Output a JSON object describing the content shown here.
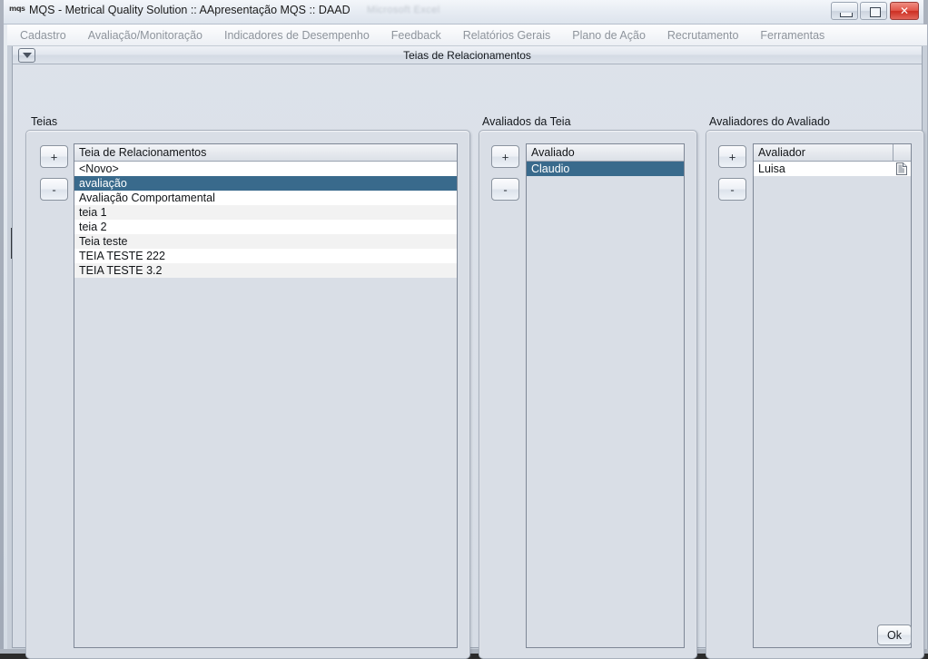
{
  "window": {
    "title": "MQS - Metrical Quality Solution :: AApresentação MQS :: DAAD",
    "logo": "mqs",
    "ghost_text": "Microsoft Excel",
    "controls": {
      "minimize": "minimize-button",
      "maximize": "maximize-button",
      "close": "✕"
    }
  },
  "menubar": {
    "items": [
      {
        "label": "Cadastro"
      },
      {
        "label": "Avaliação/Monitoração"
      },
      {
        "label": "Indicadores de Desempenho"
      },
      {
        "label": "Feedback"
      },
      {
        "label": "Relatórios Gerais"
      },
      {
        "label": "Plano de Ação"
      },
      {
        "label": "Recrutamento"
      },
      {
        "label": "Ferramentas"
      }
    ]
  },
  "form": {
    "caption": "Teias de Relacionamentos",
    "collapse_icon": "chevron-down-icon",
    "ok_label": "Ok"
  },
  "panels": {
    "teias": {
      "title": "Teias",
      "add_label": "+",
      "remove_label": "-",
      "column_header": "Teia de Relacionamentos",
      "rows": [
        {
          "label": "<Novo>",
          "selected": false
        },
        {
          "label": "avaliação",
          "selected": true
        },
        {
          "label": "Avaliação Comportamental",
          "selected": false
        },
        {
          "label": "teia 1",
          "selected": false
        },
        {
          "label": "teia 2",
          "selected": false
        },
        {
          "label": "Teia teste",
          "selected": false
        },
        {
          "label": "TEIA TESTE 222",
          "selected": false
        },
        {
          "label": "TEIA TESTE 3.2",
          "selected": false
        }
      ]
    },
    "avaliados": {
      "title": "Avaliados da Teia",
      "add_label": "+",
      "remove_label": "-",
      "column_header": "Avaliado",
      "rows": [
        {
          "label": "Claudio",
          "selected": true
        }
      ]
    },
    "avaliadores": {
      "title": "Avaliadores do Avaliado",
      "add_label": "+",
      "remove_label": "-",
      "column_header": "Avaliador",
      "column_header_extra": "",
      "rows": [
        {
          "label": "Luisa",
          "selected": false,
          "icon": "document-icon"
        }
      ]
    }
  },
  "colors": {
    "selection": "#396a8c",
    "row_even": "#ffffff",
    "row_odd": "#f2f2f2",
    "panel_bg": "#d9dee6",
    "close_button": "#cc2f22"
  }
}
